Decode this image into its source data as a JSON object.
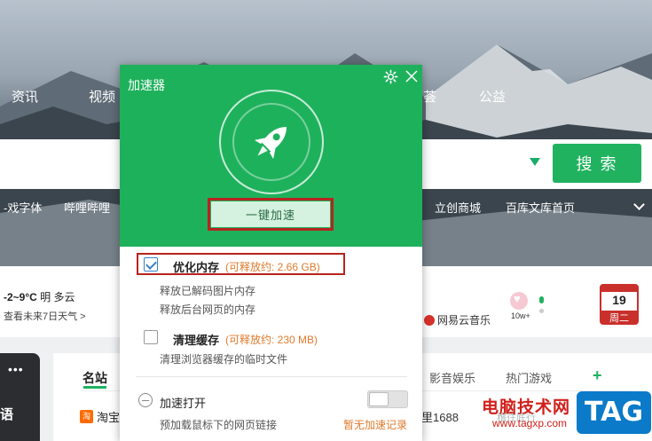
{
  "background": {
    "nav": [
      "资讯",
      "视频",
      "荟",
      "公益"
    ],
    "search": {
      "button_label": "搜 索"
    },
    "links": [
      "-戏字体",
      "哔哩哔哩",
      "立创商城",
      "百库文库首页"
    ],
    "weather": {
      "temp": "-2~9°C",
      "desc": "明 多云",
      "link": "查看未来7日天气 >"
    },
    "music": "网易云音乐",
    "likes": "10w+",
    "calendar": {
      "day": "19",
      "weekday": "周二"
    },
    "dark_card": {
      "dots": "•••",
      "lang": "语"
    },
    "tabs": {
      "active": "名站",
      "items": [
        "影音娱乐",
        "热门游戏"
      ],
      "plus": "+"
    },
    "sites": {
      "taobao": "淘宝",
      "taobao_icon": "淘",
      "site_1688": "里1688"
    },
    "watermark": {
      "brand": "电脑技术网",
      "url": "www.tagxp.com",
      "faint": "稽往底行",
      "tag": "TAG"
    }
  },
  "popup": {
    "title": "加速器",
    "accel_button": "一键加速",
    "options": [
      {
        "label": "优化内存",
        "free": "(可释放约: 2.66 GB)",
        "checked": true,
        "desc": [
          "释放已解码图片内存",
          "释放后台网页的内存"
        ]
      },
      {
        "label": "清理缓存",
        "free": "(可释放约: 230 MB)",
        "checked": false,
        "desc": [
          "清理浏览器缓存的临时文件"
        ]
      }
    ],
    "preload": {
      "label": "加速打开",
      "desc": "预加载鼠标下的网页链接",
      "link": "暂无加速记录",
      "enabled": false
    },
    "icons": {
      "settings": "gear-icon",
      "close": "close-icon",
      "hero": "rocket-icon"
    },
    "colors": {
      "accent": "#1eb15c",
      "highlight": "#b8231f",
      "free_text": "#e07a2c"
    }
  }
}
